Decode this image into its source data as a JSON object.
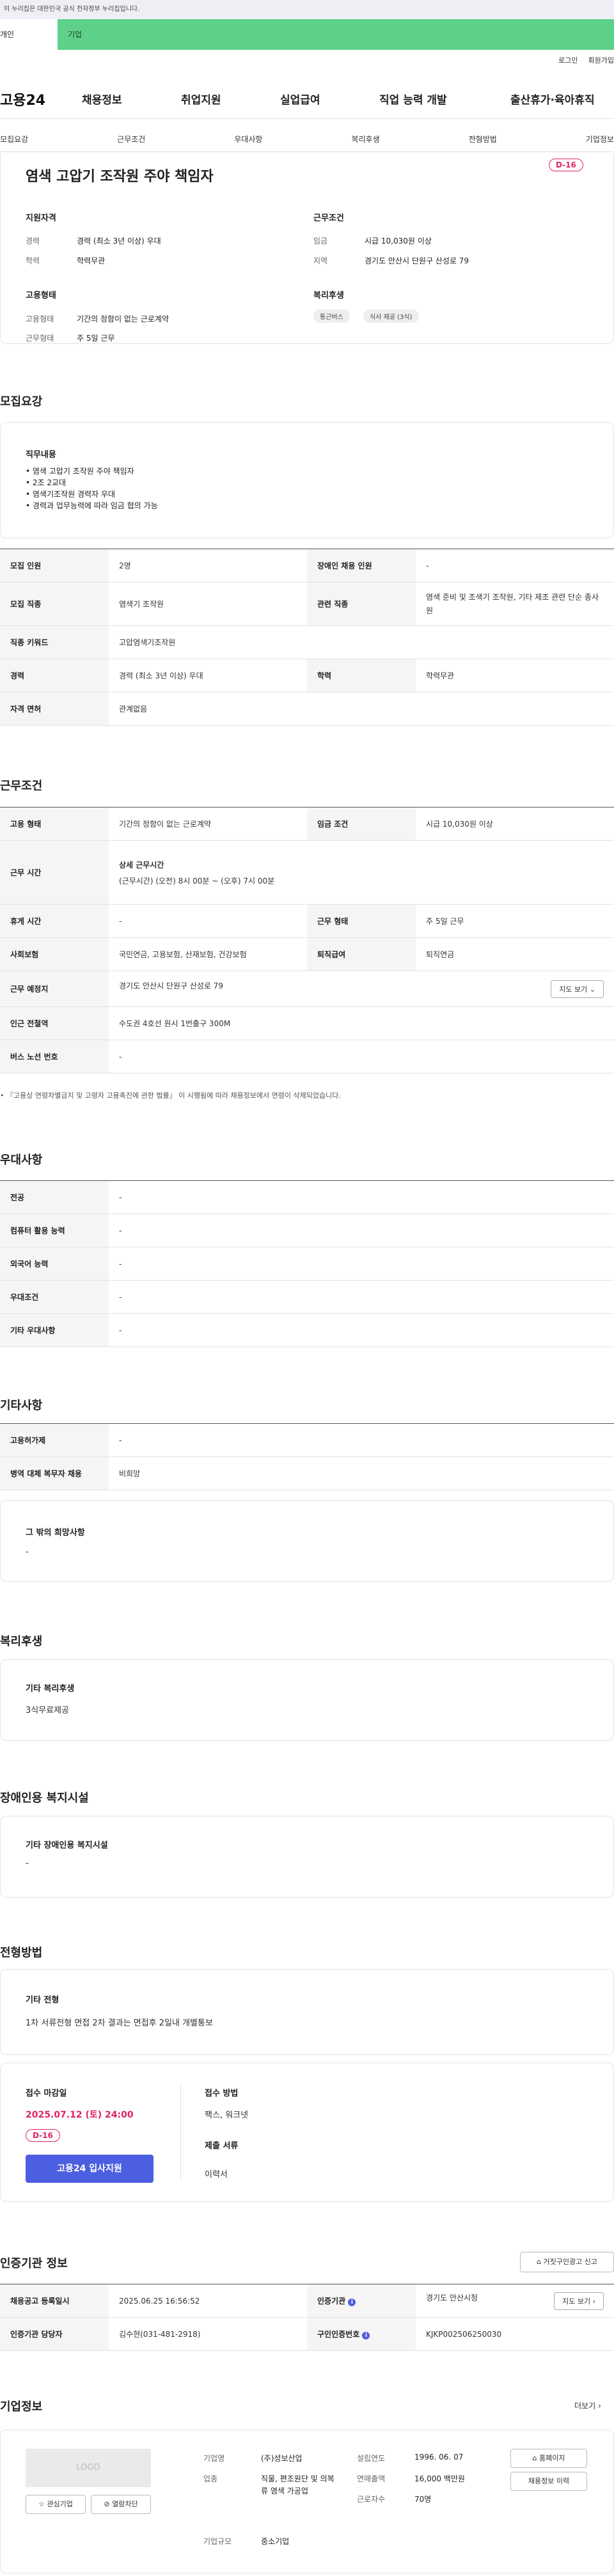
{
  "gov_banner": "이 누리집은 대한민국 공식 전자정부 누리집입니다.",
  "top_tabs": [
    "개인",
    "기업"
  ],
  "util": [
    "로그인",
    "회원가입"
  ],
  "logo": "고용24",
  "gnb": [
    "채용정보",
    "취업지원",
    "실업급여",
    "직업 능력 개발",
    "출산휴가·육아휴직"
  ],
  "subnav": [
    "모집요강",
    "근무조건",
    "우대사항",
    "복리후생",
    "전형방법",
    "기업정보"
  ],
  "job": {
    "title": "염색 고압기 조작원 주야 책임자",
    "dday": "D-16",
    "qual_h": "지원자격",
    "career_k": "경력",
    "career_v": "경력 (최소 3년 이상) 우대",
    "edu_k": "학력",
    "edu_v": "학력무관",
    "cond_h": "근무조건",
    "wage_k": "임금",
    "wage_v": "시급 10,030원 이상",
    "region_k": "지역",
    "region_v": "경기도 안산시 단원구 산성로 79",
    "emp_h": "고용형태",
    "emptype_k": "고용형태",
    "emptype_v": "기간의 정함이 없는 근로계약",
    "worktype_k": "근무형태",
    "worktype_v": "주 5일 근무",
    "welfare_h": "복리후생",
    "chips": [
      "통근버스",
      "식사 제공 (3식)"
    ]
  },
  "recruit": {
    "heading": "모집요강",
    "duty_h": "직무내용",
    "duties": [
      "• 염색 고압기 조작원 주야 책임자",
      "• 2조 2교대",
      "• 염색기조작원 경력자 우대",
      "• 경력과 업무능력에 따라 임금 협의 가능"
    ],
    "rows": [
      [
        "모집 인원",
        "2명",
        "장애인 채용 인원",
        "-"
      ],
      [
        "모집 직종",
        "염색기 조작원",
        "관련 직종",
        "염색 준비 및 조색기 조작원, 기타 제조 관련 단순 종사원"
      ],
      [
        "직종 키워드",
        "고압염색기조작원",
        "",
        ""
      ],
      [
        "경력",
        "경력 (최소 3년 이상) 우대",
        "학력",
        "학력무관"
      ],
      [
        "자격 면허",
        "관계없음",
        "",
        ""
      ]
    ]
  },
  "work": {
    "heading": "근무조건",
    "r1": [
      "고용 형태",
      "기간의 정함이 없는 근로계약",
      "임금 조건",
      "시급 10,030원 이상"
    ],
    "r2_k": "근무 시간",
    "r2_v1": "상세 근무시간",
    "r2_v2": "(근무시간) (오전) 8시 00분 ~ (오후) 7시 00분",
    "r3": [
      "휴게 시간",
      "-",
      "근무 형태",
      "주 5일 근무"
    ],
    "r4": [
      "사회보험",
      "국민연금, 고용보험, 산재보험, 건강보험",
      "퇴직급여",
      "퇴직연금"
    ],
    "r5": [
      "근무 예정지",
      "경기도 안산시 단원구 산성로 79"
    ],
    "map_btn": "지도 보기",
    "r6": [
      "인근 전철역",
      "수도권 4호선 원시 1번출구 300M"
    ],
    "r7": [
      "버스 노선 번호",
      "-"
    ],
    "note": "• 『고용상 연령차별금지 및 고령자 고용촉진에 관한 법률』 이 시행됨에 따라 채용정보에서 연령이 삭제되었습니다."
  },
  "pref": {
    "heading": "우대사항",
    "rows": [
      [
        "전공",
        "-"
      ],
      [
        "컴퓨터 활용 능력",
        "-"
      ],
      [
        "외국어 능력",
        "-"
      ],
      [
        "우대조건",
        "-"
      ],
      [
        "기타 우대사항",
        "-"
      ]
    ]
  },
  "etc": {
    "heading": "기타사항",
    "rows": [
      [
        "고용허가제",
        "-"
      ],
      [
        "병역 대체 복무자 채용",
        "비희망"
      ]
    ],
    "box_title": "그 밖의 희망사항",
    "box_text": "-"
  },
  "welfare": {
    "heading": "복리후생",
    "box_title": "기타 복리후생",
    "box_text": "3식무료제공"
  },
  "disabled": {
    "heading": "장애인용 복지시설",
    "box_title": "기타 장애인용 복지시설",
    "box_text": "-"
  },
  "selection": {
    "heading": "전형방법",
    "box_title": "기타 전형",
    "box_text": "1차 서류전형 면접 2차 결과는 면접후 2일내 개별통보",
    "deadline_h": "접수 마감일",
    "deadline": "2025.07.12 (토) 24:00",
    "dday": "D-16",
    "apply": "고용24 입사지원",
    "method_h": "접수 방법",
    "method": "팩스, 워크넷",
    "docs_h": "제출 서류",
    "docs": "이력서"
  },
  "cert": {
    "heading": "인증기관 정보",
    "report_btn": "거짓구인광고 신고",
    "r1": [
      "채용공고 등록일시",
      "2025.06.25 16:56:52",
      "인증기관",
      "경기도 안산시청"
    ],
    "map_btn": "지도 보기",
    "r2": [
      "인증기관 담당자",
      "김수현(031-481-2918)",
      "구인인증번호",
      "KJKP002506250030"
    ]
  },
  "company": {
    "heading": "기업정보",
    "more": "더보기",
    "logo": "LOGO",
    "interest_btn": "관심기업",
    "block_btn": "열람차단",
    "name_k": "기업명",
    "name_v": "(주)성보산업",
    "industry_k": "업종",
    "industry_v": "직물, 편조원단 및 의복류 염색 가공업",
    "scale_k": "기업규모",
    "scale_v": "중소기업",
    "founded_k": "설립연도",
    "founded_v": "1996. 06. 07",
    "sales_k": "연매출액",
    "sales_v": "16,000 백만원",
    "staff_k": "근로자수",
    "staff_v": "70명",
    "home_btn": "홈페이지",
    "history_btn": "채용정보 이력"
  }
}
